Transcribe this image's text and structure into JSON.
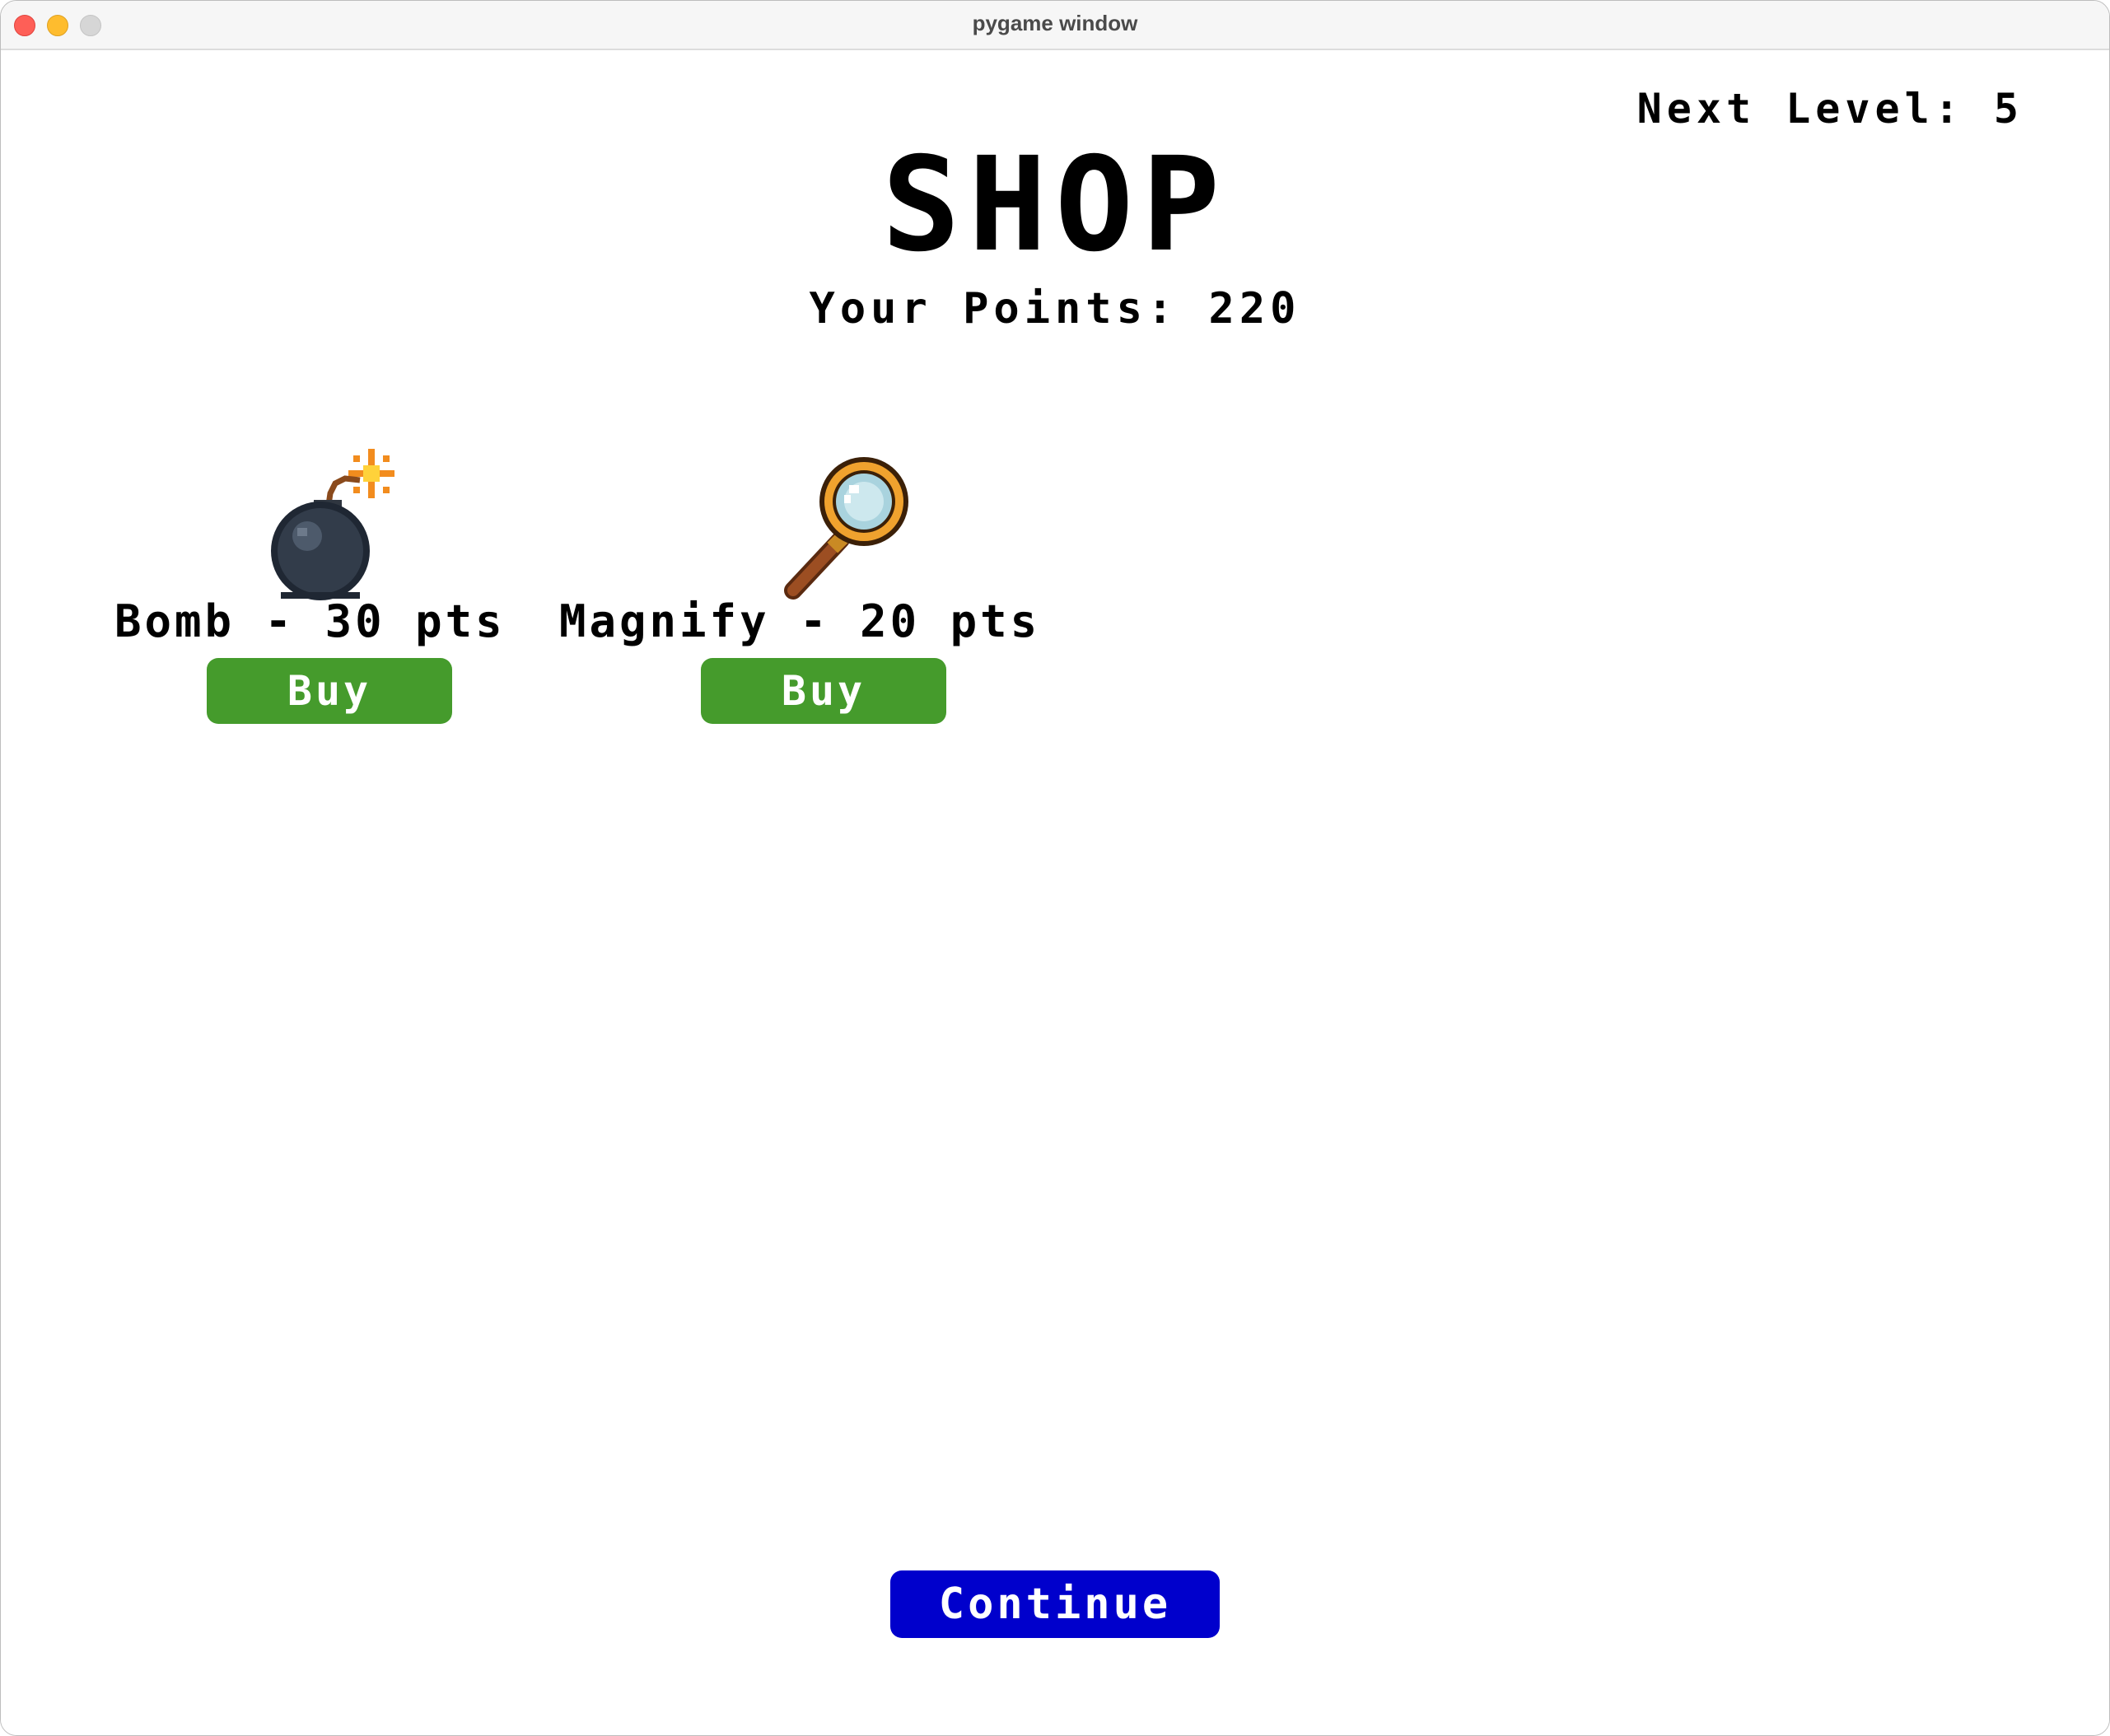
{
  "window": {
    "title": "pygame window"
  },
  "hud": {
    "next_level": "Next Level: 5",
    "shop_title": "SHOP",
    "points": "Your Points: 220"
  },
  "items": [
    {
      "label": "Bomb - 30 pts",
      "button": "Buy",
      "icon": "bomb-icon"
    },
    {
      "label": "Magnify - 20 pts",
      "button": "Buy",
      "icon": "magnifying-glass-icon"
    }
  ],
  "continue_label": "Continue",
  "colors": {
    "buy_button": "#459b2c",
    "continue_button": "#0000cc",
    "text": "#000000",
    "background": "#ffffff"
  }
}
